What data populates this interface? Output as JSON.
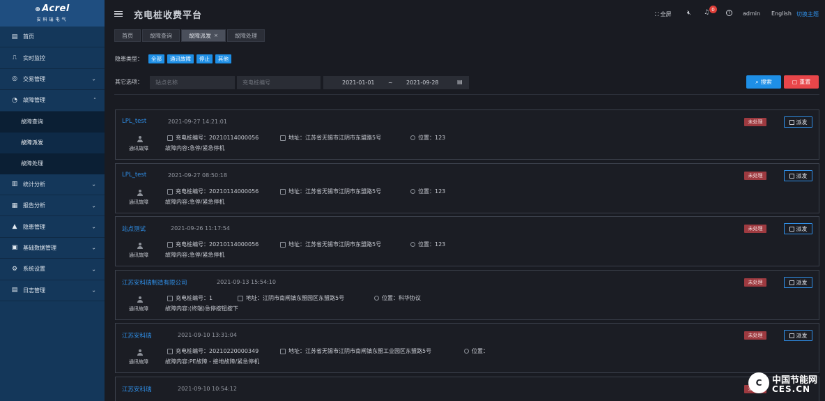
{
  "logo": {
    "brand": "Acrel",
    "sub": "安科瑞电气"
  },
  "sidebar": {
    "items": [
      {
        "label": "首页",
        "icon": "home-icon"
      },
      {
        "label": "实时监控",
        "icon": "monitor-icon"
      },
      {
        "label": "交易管理",
        "icon": "trade-icon",
        "expandable": true
      },
      {
        "label": "故障管理",
        "icon": "fault-icon",
        "expanded": true
      },
      {
        "label": "统计分析",
        "icon": "chart-icon",
        "expandable": true
      },
      {
        "label": "报告分析",
        "icon": "report-icon",
        "expandable": true
      },
      {
        "label": "隐患管理",
        "icon": "warning-icon",
        "expandable": true
      },
      {
        "label": "基础数据管理",
        "icon": "database-icon",
        "expandable": true
      },
      {
        "label": "系统设置",
        "icon": "settings-icon",
        "expandable": true
      },
      {
        "label": "日志管理",
        "icon": "log-icon",
        "expandable": true
      }
    ],
    "sub_items": [
      {
        "label": "故障查询"
      },
      {
        "label": "故障派发",
        "active": true
      },
      {
        "label": "故障处理"
      }
    ]
  },
  "header": {
    "title": "充电桩收费平台",
    "fullscreen": "全屏",
    "notification_count": "0",
    "user": "admin",
    "language": "English",
    "theme": "切换主题"
  },
  "tabs": [
    {
      "label": "首页"
    },
    {
      "label": "故障查询"
    },
    {
      "label": "故障派发",
      "active": true,
      "closable": true
    },
    {
      "label": "故障处理"
    }
  ],
  "filters": {
    "type_label": "隐患类型：",
    "types": [
      "全部",
      "通讯故障",
      "停止",
      "其他"
    ],
    "other_label": "其它选项：",
    "station_placeholder": "站点名称",
    "pile_placeholder": "充电桩编号",
    "date_start": "2021-01-01",
    "date_sep": "~",
    "date_end": "2021-09-28",
    "search_label": "搜索",
    "reset_label": "重置"
  },
  "card_labels": {
    "pile_prefix": "充电桩编号：",
    "addr_prefix": "地址：",
    "pos_prefix": "位置：",
    "status": "未处理",
    "dispatch": "派发"
  },
  "cards": [
    {
      "name": "LPL_test",
      "time": "2021-09-27 14:21:01",
      "type": "通讯故障",
      "pile": "20210114000056",
      "address": "江苏省无锡市江阴市东盟路5号",
      "position": "123",
      "content": "故障内容:急停/紧急停机"
    },
    {
      "name": "LPL_test",
      "time": "2021-09-27 08:50:18",
      "type": "通讯故障",
      "pile": "20210114000056",
      "address": "江苏省无锡市江阴市东盟路5号",
      "position": "123",
      "content": "故障内容:急停/紧急停机"
    },
    {
      "name": "站点测试",
      "time": "2021-09-26 11:17:54",
      "type": "通讯故障",
      "pile": "20210114000056",
      "address": "江苏省无锡市江阴市东盟路5号",
      "position": "123",
      "content": "故障内容:急停/紧急停机"
    },
    {
      "name": "江苏安科瑞制造有限公司",
      "time": "2021-09-13 15:54:10",
      "type": "通讯故障",
      "pile": "1",
      "address": "江阴市南闸镇东盟园区东盟路5号",
      "position": "科华协议",
      "content": "故障内容:(终端)急停按钮按下"
    },
    {
      "name": "江苏安科瑞",
      "time": "2021-09-10 13:31:04",
      "type": "通讯故障",
      "pile": "20210220000349",
      "address": "江苏省无锡市江阴市南闸镇东盟工业园区东盟路5号",
      "position": "",
      "content": "故障内容:PE故障 - 接地故障/紧急停机"
    },
    {
      "name": "江苏安科瑞",
      "time": "2021-09-10 10:54:12",
      "type": "",
      "pile": "",
      "address": "",
      "position": "",
      "content": ""
    }
  ],
  "watermark": {
    "title": "中国节能网",
    "domain": "CES.CN"
  }
}
